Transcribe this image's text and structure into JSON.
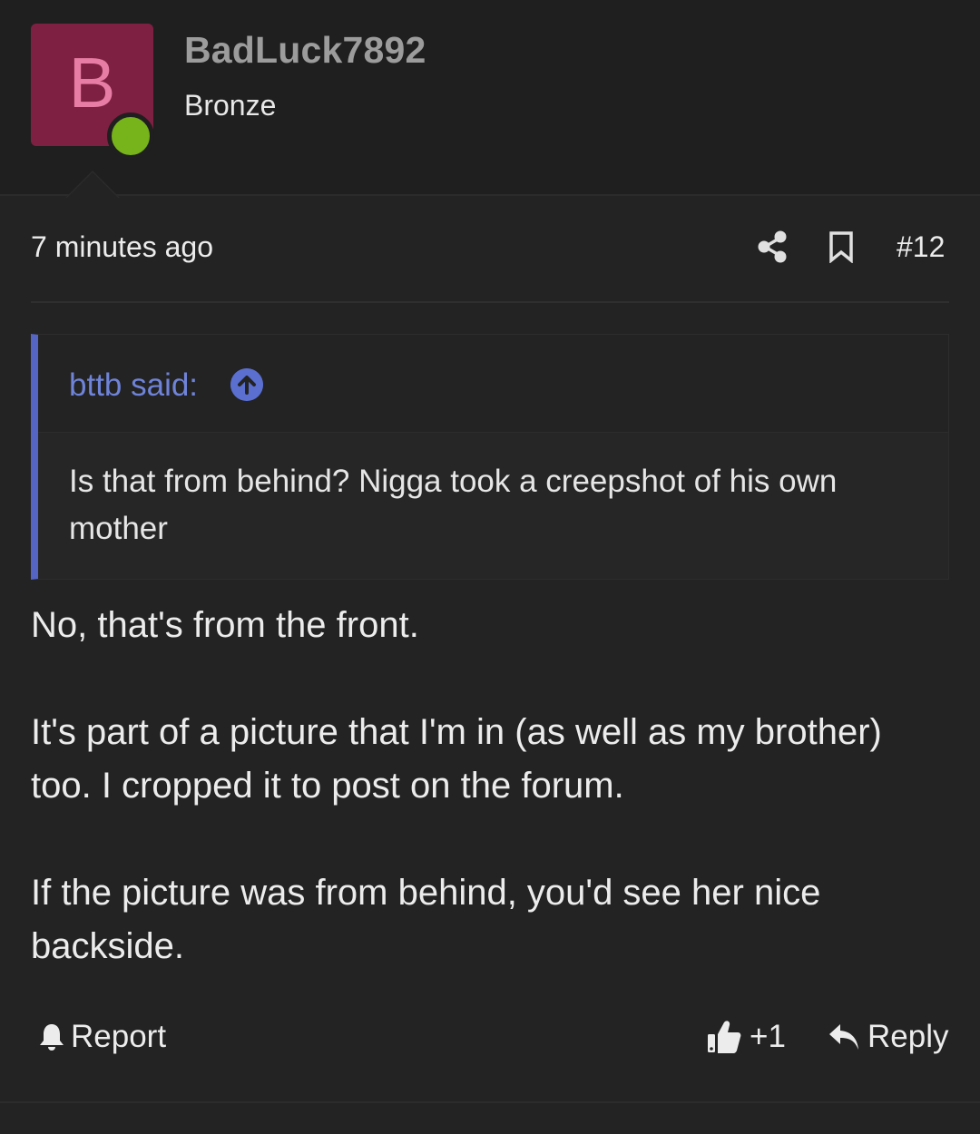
{
  "user": {
    "avatar_letter": "B",
    "username": "BadLuck7892",
    "title": "Bronze",
    "online": true,
    "avatar_color": "#7e2042",
    "online_color": "#77b31a"
  },
  "post": {
    "time": "7 minutes ago",
    "number": "#12"
  },
  "quote": {
    "author": "bttb said:",
    "text": "Is that from behind? Nigga took a creepshot of his own mother",
    "accent_color": "#5565c4"
  },
  "body": {
    "paragraphs": [
      "No, that's from the front.",
      "It's part of a picture that I'm in (as well as my brother) too. I cropped it to post on the forum.",
      "If the picture was from behind, you'd see her nice backside."
    ]
  },
  "actions": {
    "report": "Report",
    "like_count": "+1",
    "reply": "Reply"
  },
  "icons": {
    "share": "share-icon",
    "bookmark": "bookmark-icon",
    "quote_jump": "arrow-up-circle-icon",
    "report": "bell-icon",
    "like": "thumbs-up-icon",
    "reply": "reply-arrow-icon"
  }
}
